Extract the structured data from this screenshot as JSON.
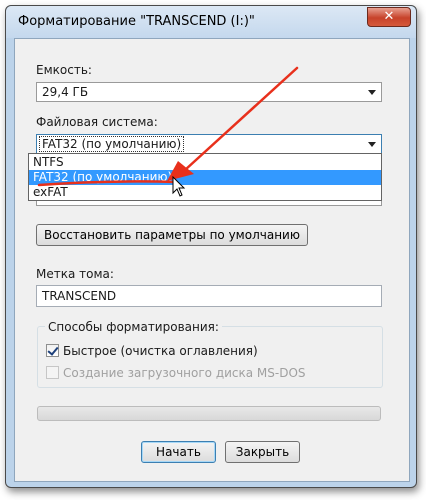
{
  "window": {
    "title": "Форматирование \"TRANSCEND (I:)\"",
    "close_glyph": "✕"
  },
  "capacity": {
    "label": "Емкость:",
    "value": "29,4 ГБ"
  },
  "filesystem": {
    "label": "Файловая система:",
    "value": "FAT32 (по умолчанию)",
    "options": [
      "NTFS",
      "FAT32 (по умолчанию)",
      "exFAT"
    ],
    "selected_index": 1
  },
  "restore_button": "Восстановить параметры по умолчанию",
  "volume_label": {
    "label": "Метка тома:",
    "value": "TRANSCEND"
  },
  "format_options": {
    "legend": "Способы форматирования:",
    "quick_label": "Быстрое (очистка оглавления)",
    "quick_checked": true,
    "msdos_label": "Создание загрузочного диска MS-DOS",
    "msdos_checked": false,
    "msdos_enabled": false
  },
  "progress": 0,
  "buttons": {
    "start": "Начать",
    "close": "Закрыть"
  },
  "colors": {
    "annotation_arrow": "#e8301c",
    "selection": "#3399ff"
  }
}
